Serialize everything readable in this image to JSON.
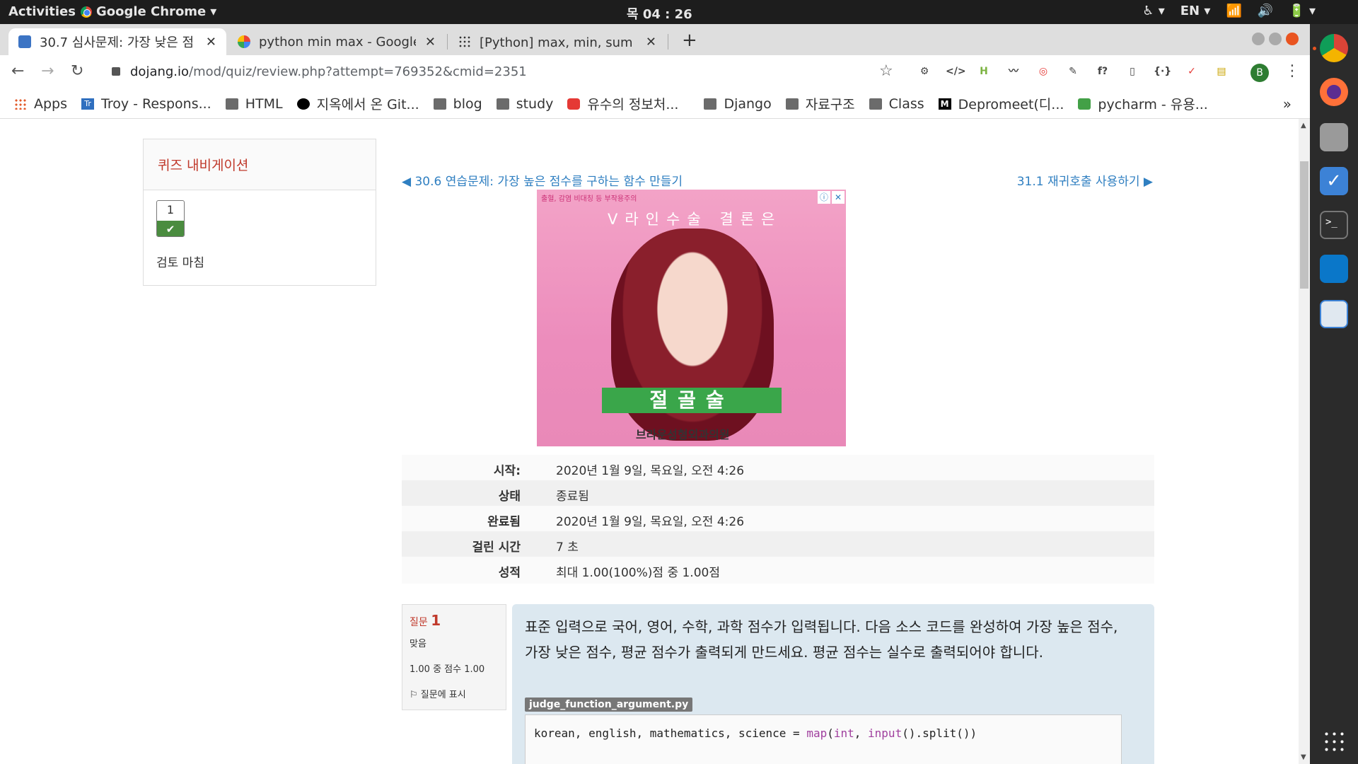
{
  "system": {
    "activities": "Activities",
    "app_name": "Google Chrome",
    "clock": "목 04 : 26",
    "lang": "EN"
  },
  "tabs": [
    {
      "title": "30.7 심사문제: 가장 낮은 점",
      "icon": "dojang-favicon"
    },
    {
      "title": "python min max - Google",
      "icon": "google-favicon"
    },
    {
      "title": "[Python] max, min, sum 내",
      "icon": "dots-favicon"
    }
  ],
  "address": {
    "host": "dojang.io",
    "path": "/mod/quiz/review.php?attempt=769352&cmid=2351"
  },
  "bookmarks": [
    {
      "label": "Apps",
      "icon": "apps-grid-icon"
    },
    {
      "label": "Troy - Respons...",
      "icon": "trello-icon"
    },
    {
      "label": "HTML",
      "icon": "folder-icon"
    },
    {
      "label": "지옥에서 온 Git...",
      "icon": "github-icon"
    },
    {
      "label": "blog",
      "icon": "folder-icon"
    },
    {
      "label": "study",
      "icon": "folder-icon"
    },
    {
      "label": "유수의 정보처...",
      "icon": "youtube-icon"
    },
    {
      "label": "Django",
      "icon": "folder-icon"
    },
    {
      "label": "자료구조",
      "icon": "folder-icon"
    },
    {
      "label": "Class",
      "icon": "folder-icon"
    },
    {
      "label": "Depromeet(디...",
      "icon": "medium-icon"
    },
    {
      "label": "pycharm - 유용...",
      "icon": "chat-icon"
    }
  ],
  "quiz_nav": {
    "title": "퀴즈 내비게이션",
    "question_number": "1",
    "finish_review": "검토 마침"
  },
  "links": {
    "prev": "◀ 30.6 연습문제: 가장 높은 점수를 구하는 함수 만들기",
    "next": "31.1 재귀호출 사용하기 ▶"
  },
  "ad": {
    "small_text": "출혈, 감염 비대칭 등 부작용주의",
    "headline": "V라인수술 결론은",
    "band": "절골술",
    "brand": "브라운성형외과의원"
  },
  "summary": [
    {
      "key": "시작",
      "value": "2020년 1월 9일, 목요일, 오전 4:26"
    },
    {
      "key": "상태",
      "value": "종료됨"
    },
    {
      "key": "완료됨",
      "value": "2020년 1월 9일, 목요일, 오전 4:26"
    },
    {
      "key": "걸린 시간",
      "value": "7 초"
    },
    {
      "key": "성적",
      "value": "최대 1.00(100%)점 중 1.00점"
    }
  ],
  "question": {
    "label": "질문",
    "number": "1",
    "state": "맞음",
    "grade": "1.00 중 점수 1.00",
    "flag": "질문에 표시",
    "text": "표준 입력으로 국어, 영어, 수학, 과학 점수가 입력됩니다. 다음 소스 코드를 완성하여 가장 높은 점수, 가장 낮은 점수, 평균 점수가 출력되게 만드세요. 평균 점수는 실수로 출력되어야 합니다.",
    "filename": "judge_function_argument.py",
    "code_vars": "korean, english, mathematics, science = ",
    "code_map": "map",
    "code_open": "(",
    "code_int": "int",
    "code_sep": ", ",
    "code_input": "input",
    "code_rest": "().split())"
  }
}
